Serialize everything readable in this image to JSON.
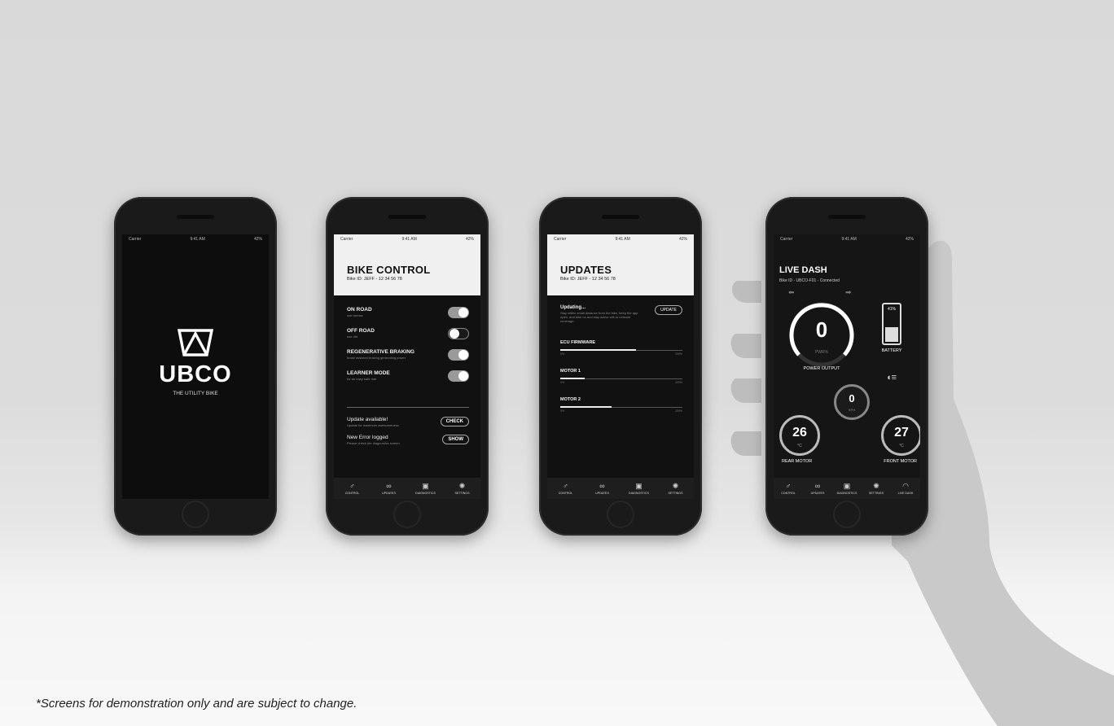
{
  "status": {
    "carrier": "Carrier",
    "time": "9:41 AM",
    "battery": "42%"
  },
  "splash": {
    "brand": "UBCO",
    "tagline": "THE UTILITY BIKE"
  },
  "bike_control": {
    "title": "BIKE CONTROL",
    "bike_id": "Bike ID: JEFF - 12 34 56 78",
    "modes": [
      {
        "label": "ON ROAD",
        "desc": "use tarmac",
        "on": true
      },
      {
        "label": "OFF ROAD",
        "desc": "use dirt",
        "on": false
      },
      {
        "label": "REGENERATIVE BRAKING",
        "desc": "brake assisted braking generating power",
        "on": true
      },
      {
        "label": "LEARNER MODE",
        "desc": "for an easy safe ride",
        "on": true
      }
    ],
    "notices": [
      {
        "label": "Update available!",
        "desc": "Update for maximum awesomeness",
        "button": "CHECK"
      },
      {
        "label": "New Error logged",
        "desc": "Please check the diagnostics screen",
        "button": "SHOW"
      }
    ]
  },
  "updates": {
    "title": "UPDATES",
    "bike_id": "Bike ID: JEFF - 12 34 56 78",
    "status_title": "Updating...",
    "status_desc": "Stay within small distance from the bike, keep the app open, and bike on and stay active wifi or network coverage.",
    "update_button": "UPDATE",
    "items": [
      {
        "label": "ECU FIRMWARE",
        "progress": 0.62,
        "min": "0%",
        "max": "100%"
      },
      {
        "label": "MOTOR 1",
        "progress": 0.2,
        "min": "0%",
        "max": "100%"
      },
      {
        "label": "MOTOR 2",
        "progress": 0.42,
        "min": "0%",
        "max": "100%"
      }
    ]
  },
  "tabs": [
    {
      "label": "CONTROL",
      "icon": "bike-icon",
      "glyph": "♂"
    },
    {
      "label": "UPDATES",
      "icon": "updates-icon",
      "glyph": "∞"
    },
    {
      "label": "DIAGNOSTICS",
      "icon": "diagnostics-icon",
      "glyph": "▣"
    },
    {
      "label": "SETTINGS",
      "icon": "settings-icon",
      "glyph": "✺"
    }
  ],
  "live_dash": {
    "title": "LIVE DASH",
    "bike_id": "Bike ID - UBCO-F01 - Connected",
    "power_value": "0",
    "power_unit": "PWR%",
    "power_label": "POWER OUTPUT",
    "battery_pct": "41%",
    "battery_label": "BATTERY",
    "battery_level": 0.41,
    "speed_value": "0",
    "speed_unit": "KPH",
    "rear_value": "26",
    "rear_unit": "°C",
    "rear_label": "REAR MOTOR",
    "front_value": "27",
    "front_unit": "°C",
    "front_label": "FRONT MOTOR",
    "tabs": [
      "CONTROL",
      "UPDATES",
      "DIAGNOSTICS",
      "SETTINGS",
      "LIVE DASH"
    ]
  },
  "caption": "*Screens for demonstration only and are subject to change."
}
